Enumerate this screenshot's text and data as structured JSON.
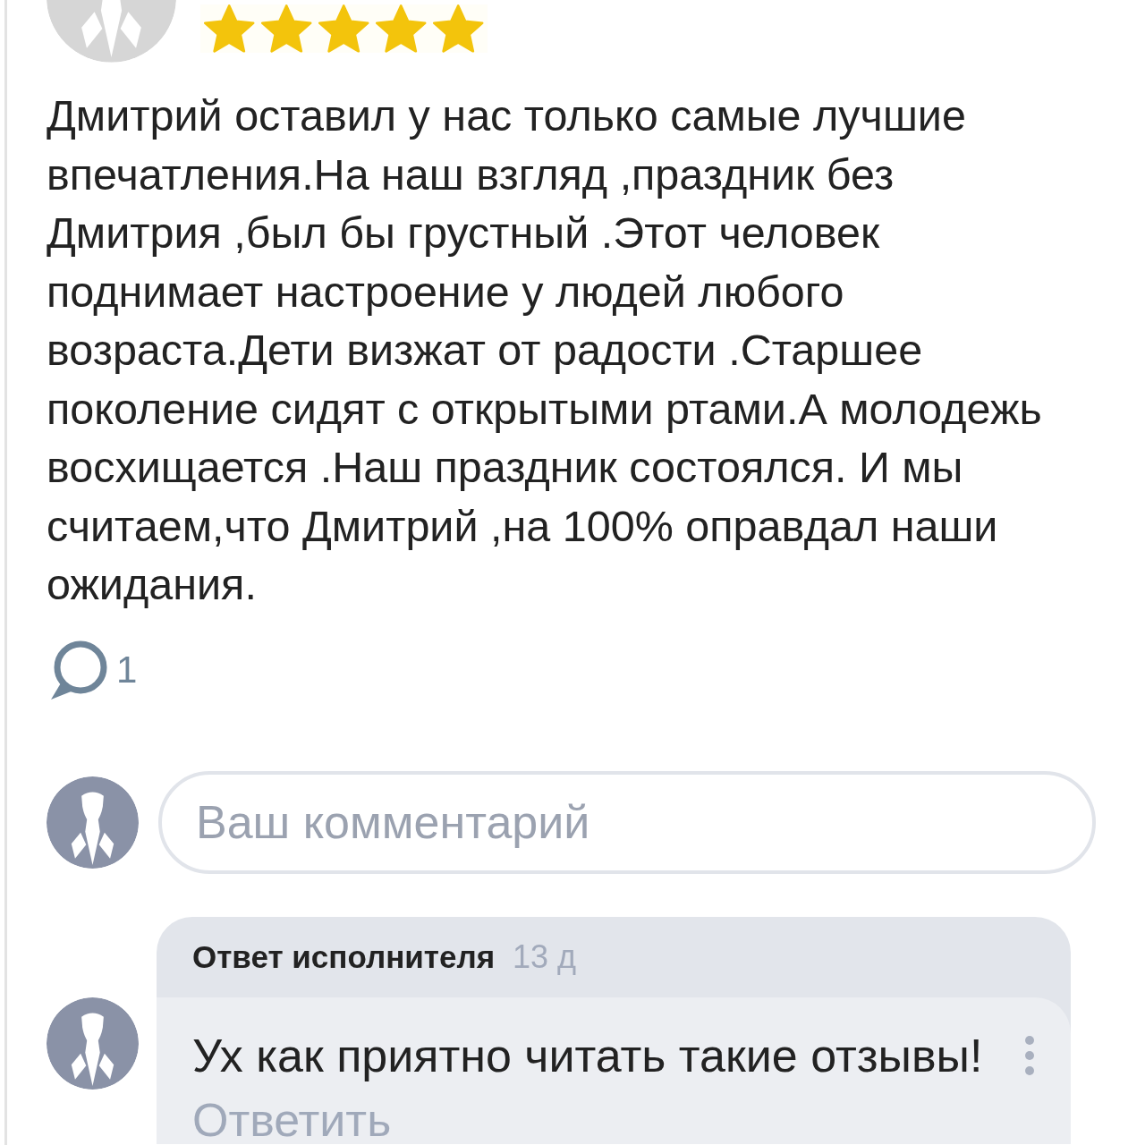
{
  "review": {
    "stars": 5,
    "text": "Дмитрий оставил у нас только самые лучшие впечатления.На наш взгляд ,праздник без Дмитрия ,был бы грустный .Этот человек поднимает настроение у людей любого возраста.Дети визжат от радости .Старшее поколение сидят с открытыми ртами.А молодежь восхищается .Наш праздник состоялся. И мы считаем,что Дмитрий ,на 100% оправдал наши ожидания.",
    "comments_count": "1"
  },
  "comment_input": {
    "placeholder": "Ваш комментарий"
  },
  "reply": {
    "author": "Ответ исполнителя",
    "age": "13 д",
    "text": "Ух как приятно читать такие отзывы!",
    "reply_link": "Ответить"
  }
}
